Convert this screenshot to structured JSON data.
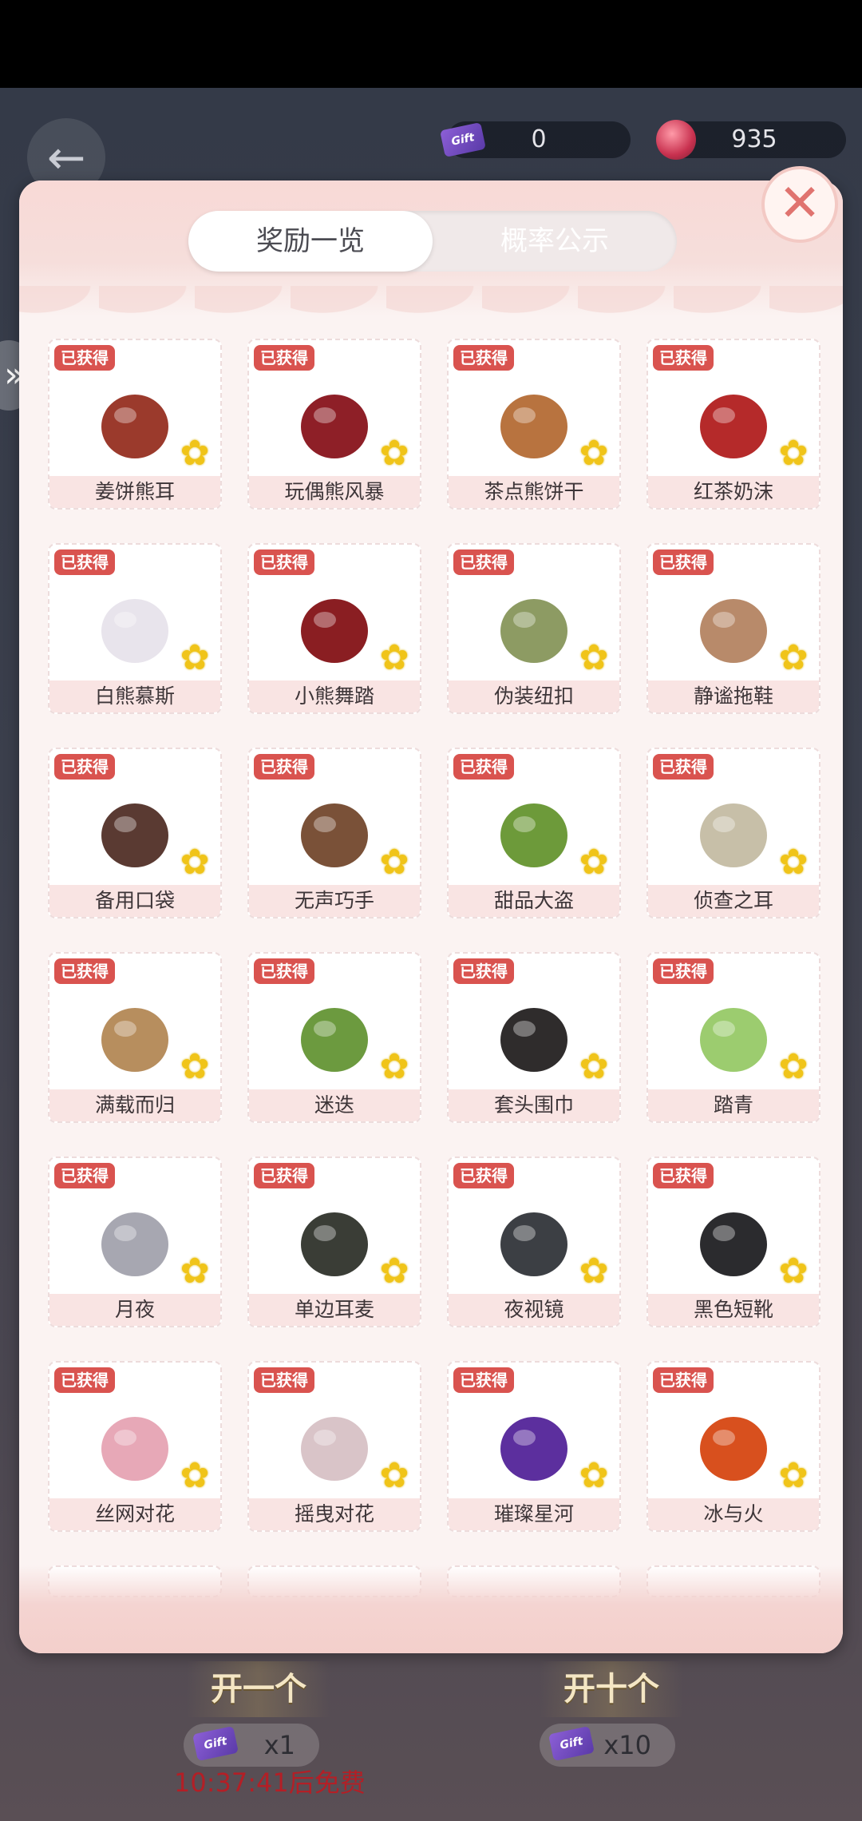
{
  "header": {
    "ticket_balance": "0",
    "gem_balance": "935"
  },
  "modal": {
    "tabs": [
      {
        "label": "奖励一览"
      },
      {
        "label": "概率公示"
      }
    ],
    "badge_text": "已获得",
    "items": [
      {
        "name": "姜饼熊耳",
        "color": "#9b3a2c"
      },
      {
        "name": "玩偶熊风暴",
        "color": "#8e1f27"
      },
      {
        "name": "茶点熊饼干",
        "color": "#b8733f"
      },
      {
        "name": "红茶奶沫",
        "color": "#b52a2a"
      },
      {
        "name": "白熊慕斯",
        "color": "#e8e4ec"
      },
      {
        "name": "小熊舞踏",
        "color": "#8a1e22"
      },
      {
        "name": "伪装纽扣",
        "color": "#8d9b63"
      },
      {
        "name": "静谧拖鞋",
        "color": "#b88a6a"
      },
      {
        "name": "备用口袋",
        "color": "#5a3a32"
      },
      {
        "name": "无声巧手",
        "color": "#7a5138"
      },
      {
        "name": "甜品大盗",
        "color": "#6d9a3a"
      },
      {
        "name": "侦查之耳",
        "color": "#c7bfa8"
      },
      {
        "name": "满载而归",
        "color": "#b78e5e"
      },
      {
        "name": "迷迭",
        "color": "#6c9a3f"
      },
      {
        "name": "套头围巾",
        "color": "#2f2c2c"
      },
      {
        "name": "踏青",
        "color": "#9ccc6f"
      },
      {
        "name": "月夜",
        "color": "#a7a7b1"
      },
      {
        "name": "单边耳麦",
        "color": "#3a3d36"
      },
      {
        "name": "夜视镜",
        "color": "#3c3f44"
      },
      {
        "name": "黑色短靴",
        "color": "#2b2b2e"
      },
      {
        "name": "丝网对花",
        "color": "#e7a8b7"
      },
      {
        "name": "摇曳对花",
        "color": "#d9c4c8"
      },
      {
        "name": "璀璨星河",
        "color": "#5c2f9e"
      },
      {
        "name": "冰与火",
        "color": "#d8501e"
      }
    ]
  },
  "bottom": {
    "draw_one_label": "开一个",
    "draw_ten_label": "开十个",
    "draw_one_cost": "x1",
    "draw_ten_cost": "x10",
    "timer_text": "10:37:41后免费"
  }
}
